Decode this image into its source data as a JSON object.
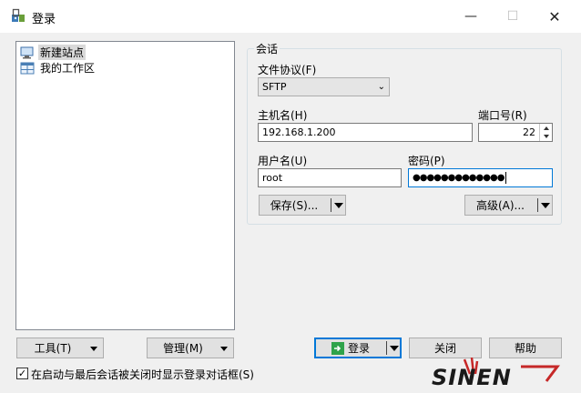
{
  "window": {
    "title": "登录"
  },
  "tree": {
    "items": [
      {
        "label": "新建站点",
        "icon": "new-site-icon",
        "selected": true
      },
      {
        "label": "我的工作区",
        "icon": "workspace-icon",
        "selected": false
      }
    ]
  },
  "session": {
    "group_label": "会话",
    "protocol_label": "文件协议(F)",
    "protocol_value": "SFTP",
    "host_label": "主机名(H)",
    "host_value": "192.168.1.200",
    "port_label": "端口号(R)",
    "port_value": "22",
    "user_label": "用户名(U)",
    "user_value": "root",
    "password_label": "密码(P)",
    "password_value": "●●●●●●●●●●●●●",
    "save_label": "保存(S)...",
    "advanced_label": "高级(A)..."
  },
  "bottom": {
    "tools_label": "工具(T)",
    "manage_label": "管理(M)",
    "login_label": "登录",
    "close_label": "关闭",
    "help_label": "帮助",
    "show_on_startup_label": "在启动与最后会话被关闭时显示登录对话框(S)",
    "show_on_startup_checked": true
  },
  "watermark": {
    "text": "SINEN"
  },
  "colors": {
    "accent": "#0078d7",
    "login_icon": "#2fa34a",
    "watermark": "#c62828"
  }
}
